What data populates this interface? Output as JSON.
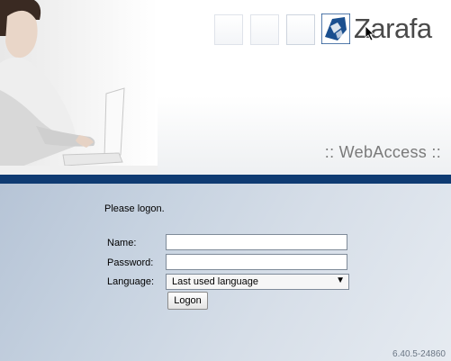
{
  "brand": {
    "logo_text": "Zarafa",
    "product": ":: WebAccess ::",
    "primary_color": "#0f3b72"
  },
  "login": {
    "welcome": "Please logon.",
    "name_label": "Name:",
    "name_value": "",
    "password_label": "Password:",
    "password_value": "",
    "language_label": "Language:",
    "language_selected": "Last used language",
    "submit_label": "Logon"
  },
  "footer": {
    "version": "6.40.5-24860"
  }
}
